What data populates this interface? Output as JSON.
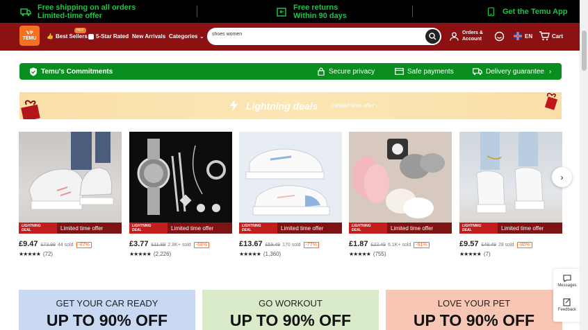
{
  "promo": {
    "shipping_title": "Free shipping on all orders",
    "shipping_sub": "Limited-time offer",
    "returns_title": "Free returns",
    "returns_sub": "Within 90 days",
    "app": "Get the Temu App"
  },
  "header": {
    "logo_top": "ꔄꕢ",
    "logo_text": "TEMU",
    "best_sellers": "Best Sellers",
    "hot": "HOT",
    "five_star": "5-Star Rated",
    "new_arrivals": "New Arrivals",
    "categories": "Categories",
    "search_value": "shoes women",
    "orders_line1": "Orders &",
    "orders_line2": "Account",
    "language": "EN",
    "cart": "Cart"
  },
  "commitments": {
    "title": "Temu's Commitments",
    "privacy": "Secure privacy",
    "payments": "Safe payments",
    "delivery": "Delivery guarantee"
  },
  "lightning": {
    "title": "Lightning deals",
    "sub": "Limited time offer"
  },
  "products": [
    {
      "price": "£9.47",
      "old": "£73.99",
      "sold": "44 sold",
      "discount": "-87%",
      "rating_count": "(72)",
      "tag_line1": "LIGHTNING",
      "tag_line2": "DEAL",
      "tag": "Limited time offer",
      "stars": "★★★★★"
    },
    {
      "price": "£3.77",
      "old": "£11.99",
      "sold": "2.8K+ sold",
      "discount": "-68%",
      "rating_count": "(2,226)",
      "tag_line1": "LIGHTNING",
      "tag_line2": "DEAL",
      "tag": "Limited time offer",
      "stars": "★★★★★"
    },
    {
      "price": "£13.67",
      "old": "£59.49",
      "sold": "170 sold",
      "discount": "-77%",
      "rating_count": "(1,360)",
      "tag_line1": "LIGHTNING",
      "tag_line2": "DEAL",
      "tag": "Limited time offer",
      "stars": "★★★★★"
    },
    {
      "price": "£1.87",
      "old": "£22.49",
      "sold": "6.1K+ sold",
      "discount": "-91%",
      "rating_count": "(755)",
      "tag_line1": "LIGHTNING",
      "tag_line2": "DEAL",
      "tag": "Limited time offer",
      "stars": "★★★★★"
    },
    {
      "price": "£9.57",
      "old": "£48.49",
      "sold": "28 sold",
      "discount": "-80%",
      "rating_count": "(7)",
      "tag_line1": "LIGHTNING",
      "tag_line2": "DEAL",
      "tag": "Limited time offer",
      "stars": "★★★★★"
    }
  ],
  "categories": [
    {
      "heading": "GET YOUR CAR READY",
      "offer": "UP TO 90% OFF",
      "color": "#c9d9f4"
    },
    {
      "heading": "GO WORKOUT",
      "offer": "UP TO 90% OFF",
      "color": "#d9ebc9"
    },
    {
      "heading": "LOVE YOUR PET",
      "offer": "UP TO 90% OFF",
      "color": "#f7c6b4"
    }
  ],
  "side": {
    "messages": "Messages",
    "feedback": "Feedback"
  },
  "colors": {
    "header": "#8b1113",
    "promo_green": "#1ec44a",
    "commit_green": "#0a8e1f",
    "accent": "#f4711f"
  }
}
